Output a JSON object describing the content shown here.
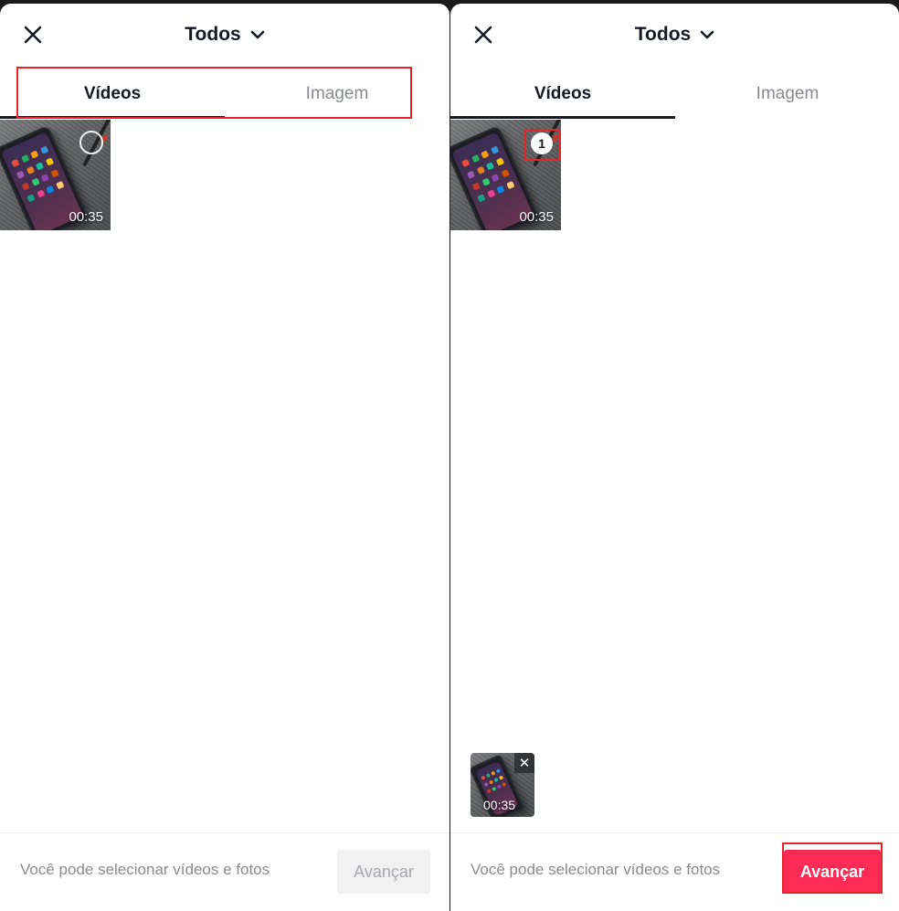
{
  "colors": {
    "brand_red": "#fe2c55",
    "highlight_red": "#e8242b",
    "text_primary": "#161823",
    "text_secondary": "#8a8b91",
    "disabled_button_bg": "#f1f1f2"
  },
  "icons": {
    "close": "close-icon",
    "dropdown": "chevron-down-icon",
    "remove": "remove-icon"
  },
  "left": {
    "album_title": "Todos",
    "tabs": [
      {
        "label": "Vídeos",
        "active": true
      },
      {
        "label": "Imagem",
        "active": false
      }
    ],
    "media": [
      {
        "duration": "00:35",
        "selected": false
      }
    ],
    "footer": {
      "hint": "Você pode selecionar vídeos e fotos",
      "next_label": "Avançar",
      "next_enabled": false
    }
  },
  "right": {
    "album_title": "Todos",
    "tabs": [
      {
        "label": "Vídeos",
        "active": true
      },
      {
        "label": "Imagem",
        "active": false
      }
    ],
    "media": [
      {
        "duration": "00:35",
        "selected": true,
        "selection_number": "1"
      }
    ],
    "selected_tray": [
      {
        "duration": "00:35"
      }
    ],
    "footer": {
      "hint": "Você pode selecionar vídeos e fotos",
      "next_label": "Avançar",
      "next_enabled": true
    }
  }
}
